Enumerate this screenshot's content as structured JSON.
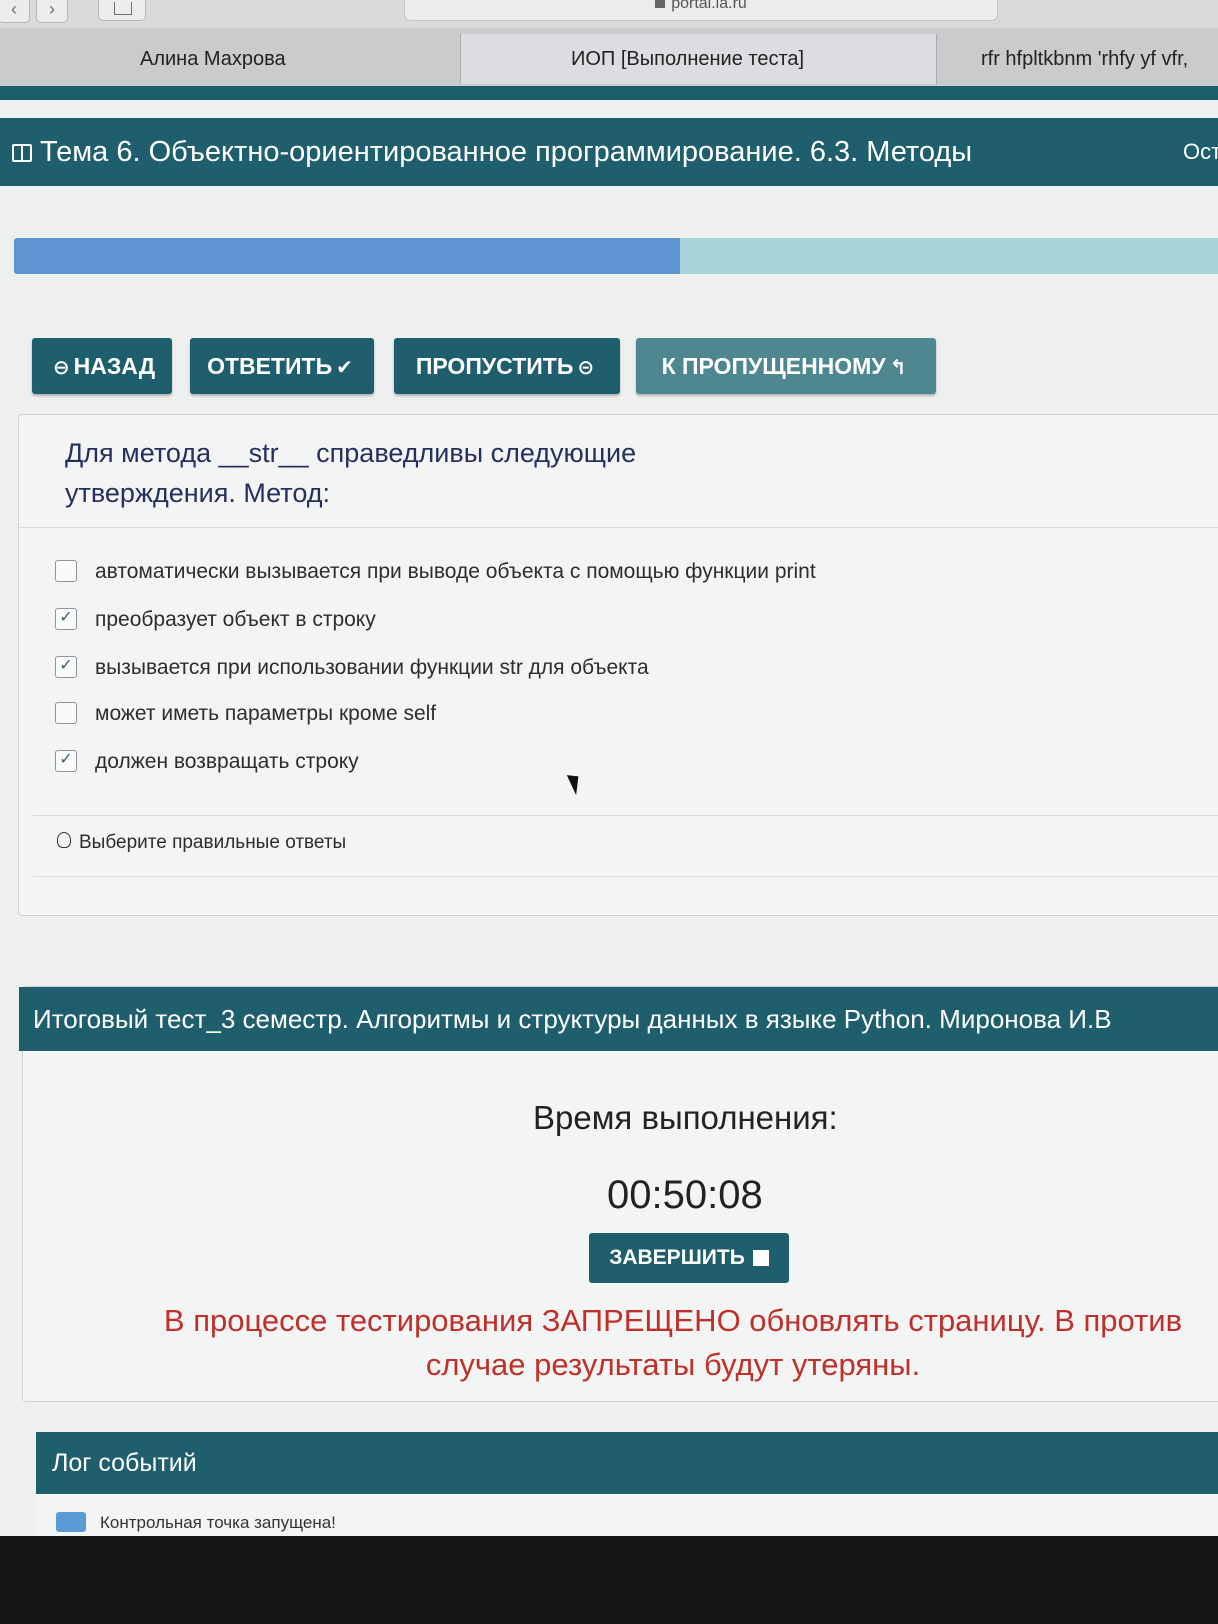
{
  "browser": {
    "url": "portal.ia.ru",
    "back_glyph": "‹",
    "forward_glyph": "›",
    "tabs": [
      {
        "label": "Алина Махрова"
      },
      {
        "label": "ИОП [Выполнение теста]"
      },
      {
        "label": "rfr hfpltkbnm 'rhfy yf vfr,"
      }
    ]
  },
  "topic": {
    "title": "Тема 6. Объектно-ориентированное программирование. 6.3. Методы",
    "right_label": "Ост"
  },
  "progress": {
    "fraction": 0.55
  },
  "buttons": {
    "back": "НАЗАД",
    "answer": "ОТВЕТИТЬ",
    "skip": "ПРОПУСТИТЬ",
    "to_skipped": "К ПРОПУЩЕННОМУ",
    "back_icon": "⊖",
    "answer_icon": "✔",
    "skip_icon": "⊝",
    "to_skipped_icon": "↰"
  },
  "question": {
    "text_line1": "Для метода __str__ справедливы следующие",
    "text_line2": "утверждения. Метод:",
    "options": [
      {
        "label": "автоматически вызывается при выводе объекта с помощью функции print",
        "checked": false,
        "mark": ""
      },
      {
        "label": "преобразует объект в строку",
        "checked": true,
        "mark": "✓"
      },
      {
        "label": "вызывается при использовании функции str для объекта",
        "checked": true,
        "mark": "✓"
      },
      {
        "label": "может иметь параметры кроме self",
        "checked": false,
        "mark": ""
      },
      {
        "label": "должен возвращать строку",
        "checked": true,
        "mark": "✓"
      }
    ],
    "hint": "Выберите правильные ответы"
  },
  "test": {
    "title": "Итоговый тест_3 семестр. Алгоритмы и структуры данных в языке Python. Миронова И.В",
    "time_label": "Время выполнения:",
    "time_value": "00:50:08",
    "finish": "ЗАВЕРШИТЬ",
    "warning_line1": "В процессе тестирования ЗАПРЕЩЕНО обновлять страницу. В против",
    "warning_line2": "случае результаты будут утеряны."
  },
  "log": {
    "title": "Лог событий",
    "items": [
      "Контрольная точка запущена!"
    ]
  },
  "colors": {
    "accent": "#1f5e6c",
    "progress_fill": "#5c95cf",
    "progress_track": "#a6d4d8",
    "warning": "#c0302b"
  }
}
